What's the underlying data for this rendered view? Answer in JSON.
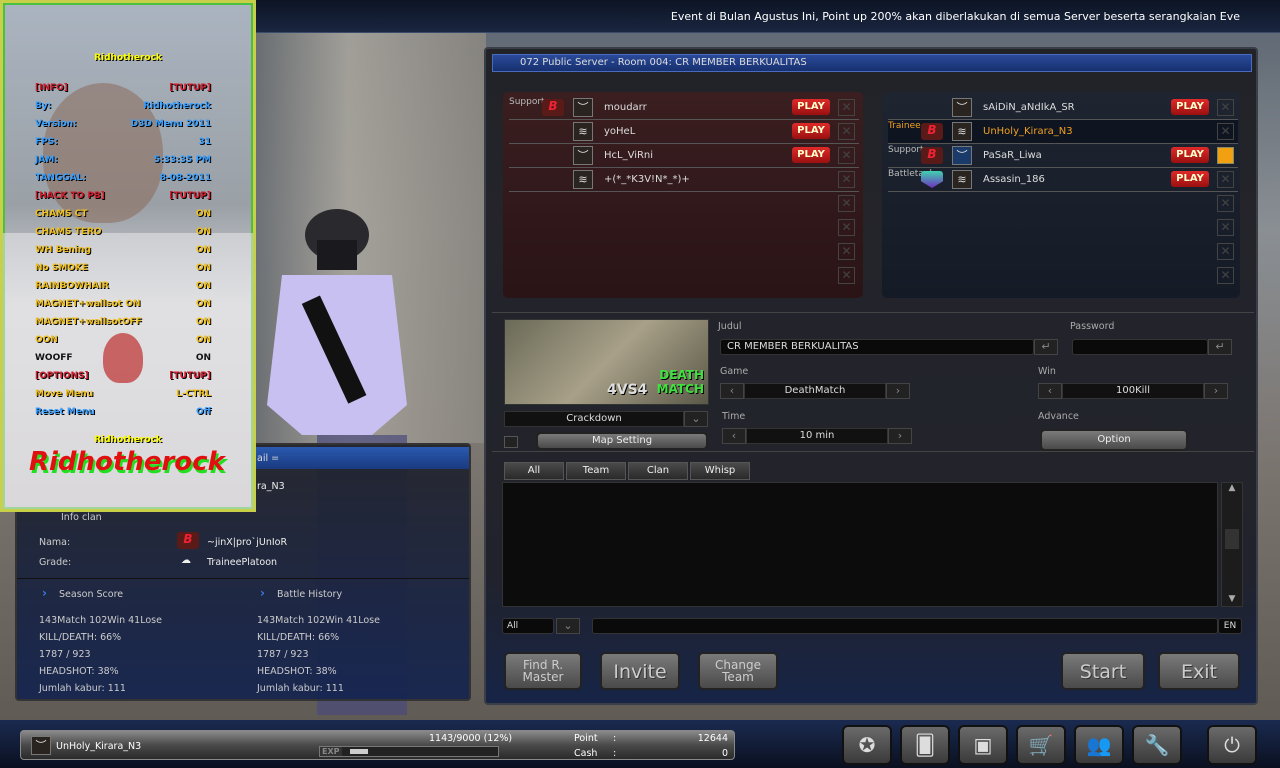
{
  "ticker": "Event di Bulan Agustus Ini, Point up 200% akan diberlakukan di semua Server beserta serangkaian Eve",
  "cheat_menu": {
    "title": "Ridhotherock",
    "rows": [
      {
        "label": "[INFO]",
        "value": "[TUTUP]",
        "color": "red"
      },
      {
        "label": "By:",
        "value": "Ridhotherock",
        "color": "blue"
      },
      {
        "label": "Version:",
        "value": "D3D Menu 2011",
        "color": "blue"
      },
      {
        "label": "FPS:",
        "value": "31",
        "color": "blue"
      },
      {
        "label": "JAM:",
        "value": "5:33:35 PM",
        "color": "blue"
      },
      {
        "label": "TANGGAL:",
        "value": "8-08-2011",
        "color": "blue"
      },
      {
        "label": "[HACK TO PB]",
        "value": "[TUTUP]",
        "color": "red"
      },
      {
        "label": "CHAMS CT",
        "value": "ON",
        "color": "yellow"
      },
      {
        "label": "CHAMS TERO",
        "value": "ON",
        "color": "yellow"
      },
      {
        "label": "WH Bening",
        "value": "ON",
        "color": "yellow"
      },
      {
        "label": "No SMOKE",
        "value": "ON",
        "color": "yellow"
      },
      {
        "label": "RAINBOWHAIR",
        "value": "ON",
        "color": "yellow"
      },
      {
        "label": "MAGNET+wallsot ON",
        "value": "ON",
        "color": "yellow"
      },
      {
        "label": "MAGNET+wallsotOFF",
        "value": "ON",
        "color": "yellow"
      },
      {
        "label": "OON",
        "value": "ON",
        "color": "yellow"
      },
      {
        "label": "WOOFF",
        "value": "ON",
        "color": "black"
      },
      {
        "label": "[OPTIONS]",
        "value": "[TUTUP]",
        "color": "red"
      },
      {
        "label": "Move Menu",
        "value": "L-CTRL",
        "color": "yellow"
      },
      {
        "label": "Reset Menu",
        "value": "Off",
        "color": "blue"
      }
    ],
    "footer": "Ridhotherock",
    "logo_text": "Ridhotherock"
  },
  "room": {
    "title": "072 Public Server - Room 004: CR MEMBER BERKUALITAS",
    "red_team": [
      {
        "rank": "Support",
        "clan": "pb",
        "name": "moudarr",
        "status": "PLAY"
      },
      {
        "rank": "",
        "clan": "",
        "name": "yoHeL",
        "status": "PLAY"
      },
      {
        "rank": "",
        "clan": "",
        "name": "HcL_ViRni",
        "status": "PLAY"
      },
      {
        "rank": "",
        "clan": "",
        "name": "+(*_*K3V!N*_*)+",
        "status": ""
      },
      null,
      null,
      null,
      null
    ],
    "blue_team": [
      {
        "rank": "",
        "clan": "",
        "name": "sAiDiN_aNdIkA_SR",
        "status": "PLAY"
      },
      {
        "rank": "Trainee",
        "clan": "pb",
        "name": "UnHoly_Kirara_N3",
        "status": "",
        "me": true
      },
      {
        "rank": "Support",
        "clan": "pb",
        "name": "PaSaR_Liwa",
        "status": "PLAY",
        "ready": true
      },
      {
        "rank": "Battletank",
        "clan": "bt",
        "name": "Assasin_186",
        "status": "PLAY"
      },
      null,
      null,
      null,
      null
    ],
    "settings": {
      "map_mode_line1": "DEATH",
      "map_mode_line2": "MATCH",
      "map_size": "4VS4",
      "map_name": "Crackdown",
      "map_setting_label": "Map Setting",
      "judul_label": "Judul",
      "judul_value": "CR MEMBER BERKUALITAS",
      "password_label": "Password",
      "password_value": "",
      "game_label": "Game",
      "game_value": "DeathMatch",
      "win_label": "Win",
      "win_value": "100Kill",
      "time_label": "Time",
      "time_value": "10 min",
      "advance_label": "Advance",
      "option_label": "Option"
    },
    "chat": {
      "tabs": [
        "All",
        "Team",
        "Clan",
        "Whisp"
      ],
      "channel": "All",
      "input_value": "",
      "lang": "EN"
    },
    "buttons": {
      "find_master": "Find R. Master",
      "invite": "Invite",
      "change_team": "Change Team",
      "start": "Start",
      "exit": "Exit"
    }
  },
  "info": {
    "header_partial": "ail =",
    "name_partial": "ra_N3",
    "clan_section": "Info clan",
    "nama_label": "Nama:",
    "nama_value": "~jinX|pro`jUnIoR",
    "grade_label": "Grade:",
    "grade_value": "TraineePlatoon",
    "season": {
      "title": "Season Score",
      "record": "143Match 102Win 41Lose",
      "kd": "KILL/DEATH:  66%",
      "kills_deaths": "1787 / 923",
      "headshot": "HEADSHOT:  38%",
      "kabur": "Jumlah kabur: 111"
    },
    "history": {
      "title": "Battle History",
      "record": "143Match 102Win 41Lose",
      "kd": "KILL/DEATH:  66%",
      "kills_deaths": "1787 / 923",
      "headshot": "HEADSHOT:  38%",
      "kabur": "Jumlah kabur: 111"
    }
  },
  "userbar": {
    "name": "UnHoly_Kirara_N3",
    "exp_label": "EXP",
    "exp_text": "1143/9000 (12%)",
    "exp_fraction": 0.12,
    "point_label": "Point",
    "point_sep": ":",
    "point_value": "12644",
    "cash_label": "Cash",
    "cash_value": "0"
  },
  "dock": [
    {
      "icon": "clan-emblem-icon",
      "glyph": "✪"
    },
    {
      "icon": "cards-icon",
      "glyph": "🂠"
    },
    {
      "icon": "inventory-bag-icon",
      "glyph": "▣"
    },
    {
      "icon": "shop-cart-icon",
      "glyph": "🛒"
    },
    {
      "icon": "community-icon",
      "glyph": "👥"
    },
    {
      "icon": "settings-wrench-icon",
      "glyph": "🔧"
    },
    {
      "icon": "power-icon",
      "glyph": "⏻"
    }
  ]
}
